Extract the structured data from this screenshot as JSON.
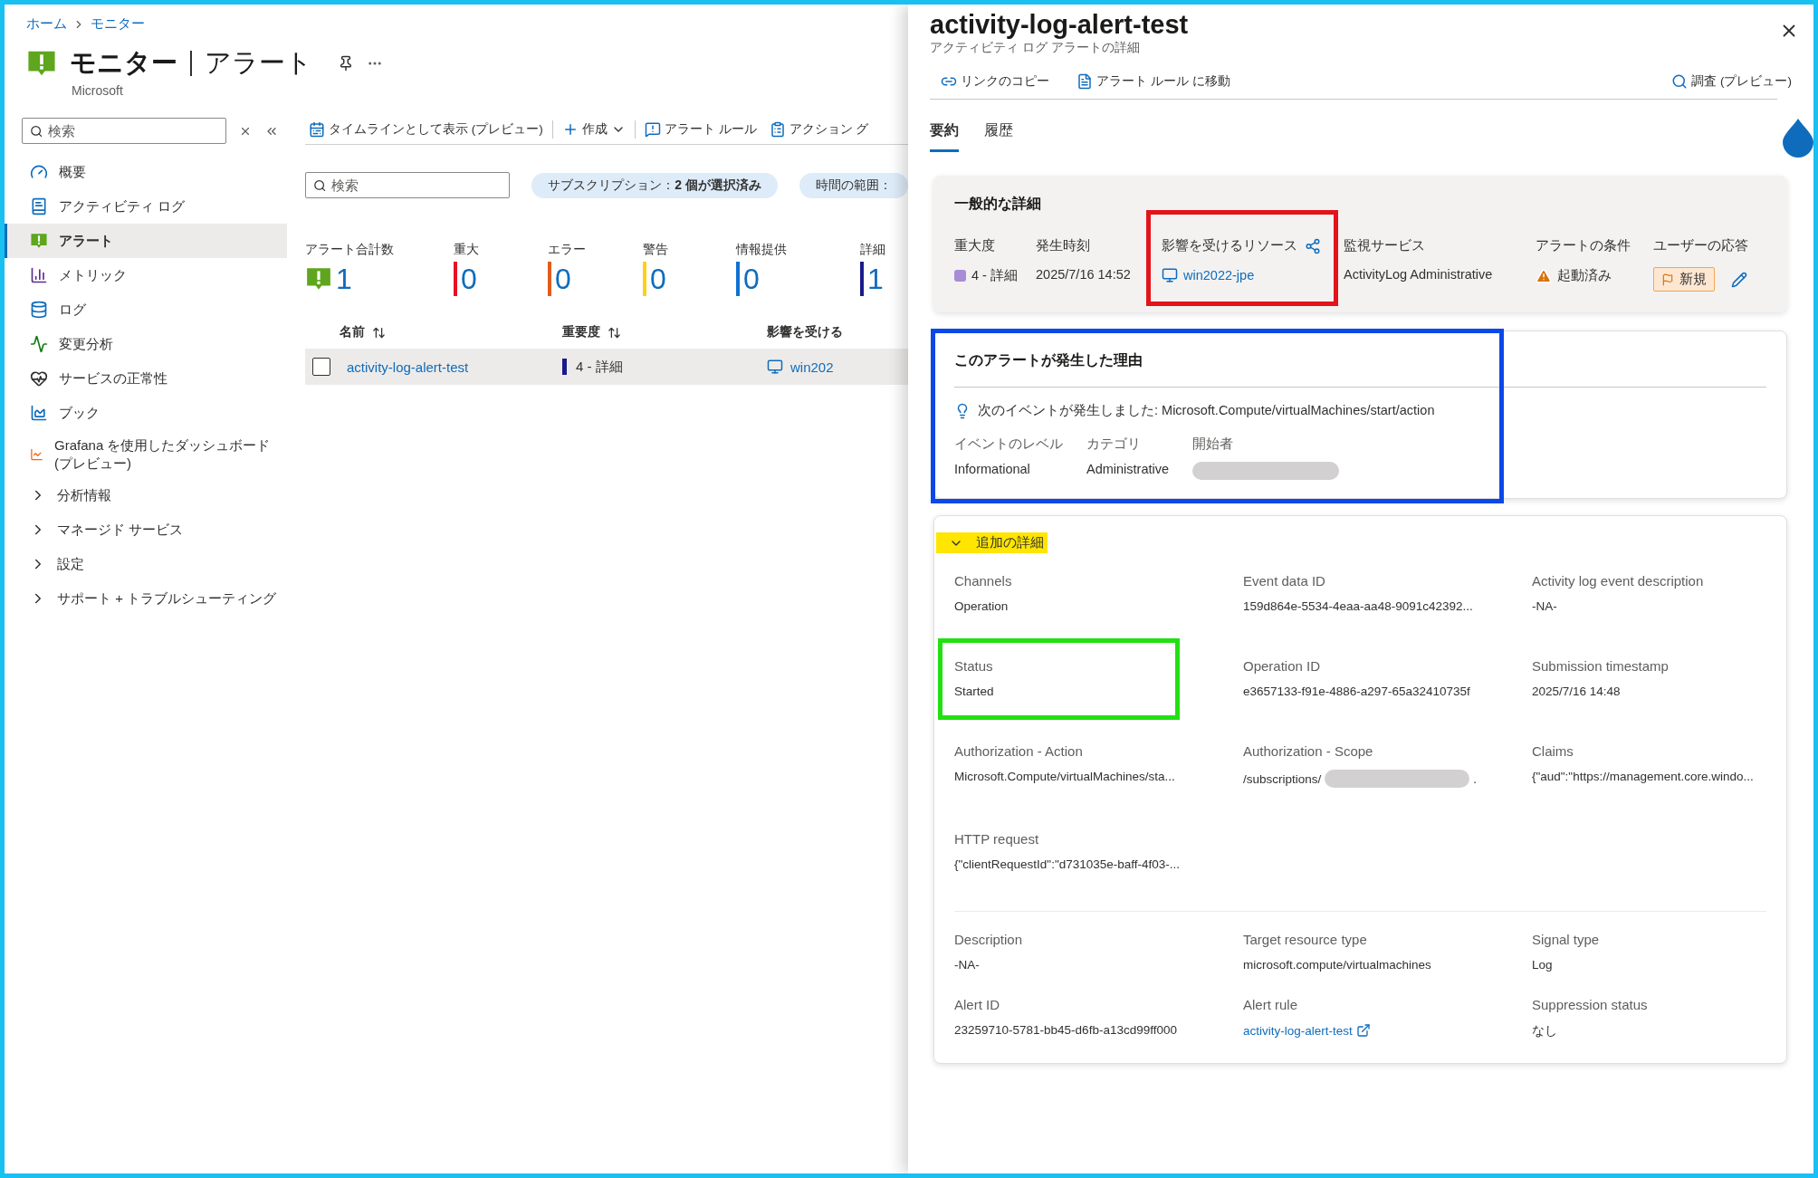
{
  "breadcrumb": [
    {
      "label": "ホーム"
    },
    {
      "label": "モニター"
    }
  ],
  "page": {
    "title": "モニター",
    "section": "アラート",
    "publisher": "Microsoft"
  },
  "sidebar": {
    "search": {
      "placeholder": "検索"
    },
    "items": [
      {
        "label": "概要",
        "kind": "link",
        "selected": false
      },
      {
        "label": "アクティビティ ログ",
        "kind": "link",
        "selected": false
      },
      {
        "label": "アラート",
        "kind": "link",
        "selected": true
      },
      {
        "label": "メトリック",
        "kind": "link",
        "selected": false
      },
      {
        "label": "ログ",
        "kind": "link",
        "selected": false
      },
      {
        "label": "変更分析",
        "kind": "link",
        "selected": false
      },
      {
        "label": "サービスの正常性",
        "kind": "link",
        "selected": false
      },
      {
        "label": "ブック",
        "kind": "link",
        "selected": false
      },
      {
        "label": "Grafana を使用したダッシュボード (プレビュー)",
        "kind": "link",
        "selected": false
      },
      {
        "label": "分析情報",
        "kind": "group",
        "expanded": false,
        "selected": false
      },
      {
        "label": "マネージド サービス",
        "kind": "group",
        "expanded": false,
        "selected": false
      },
      {
        "label": "設定",
        "kind": "group",
        "expanded": false,
        "selected": false
      },
      {
        "label": "サポート + トラブルシューティング",
        "kind": "group",
        "expanded": false,
        "selected": false
      }
    ]
  },
  "toolbar": [
    {
      "label": "タイムラインとして表示 (プレビュー)",
      "kind": "timeline"
    },
    {
      "label": "作成",
      "kind": "create"
    },
    {
      "label": "アラート ルール",
      "kind": "rule"
    },
    {
      "label": "アクション グ",
      "kind": "action"
    }
  ],
  "filters": {
    "search": {
      "placeholder": "検索"
    },
    "pills": [
      "サブスクリプション：**2 個が選択済み**",
      "時間の範囲："
    ]
  },
  "stats": [
    {
      "label": "アラート合計数",
      "value": "1",
      "kind": "total"
    },
    {
      "label": "重大",
      "value": "0",
      "kind": "severity",
      "color": "#e81123"
    },
    {
      "label": "エラー",
      "value": "0",
      "kind": "severity",
      "color": "#e05c1a"
    },
    {
      "label": "警告",
      "value": "0",
      "kind": "severity",
      "color": "#fcd116"
    },
    {
      "label": "情報提供",
      "value": "0",
      "kind": "severity",
      "color": "#1170cf"
    },
    {
      "label": "詳細",
      "value": "1",
      "kind": "severity",
      "color": "#1a1a8c"
    }
  ],
  "table": {
    "columns": [
      {
        "label": "名前",
        "sortable": true
      },
      {
        "label": "重要度",
        "sortable": true
      },
      {
        "label": "影響を受ける",
        "sortable": false
      }
    ],
    "rows": [
      {
        "checked": false,
        "selected": true,
        "name": "activity-log-alert-test",
        "severity": "4 - 詳細",
        "color": "#1a1a8c",
        "resource": "win202"
      }
    ]
  },
  "panel": {
    "title": "activity-log-alert-test",
    "subtitle": "アクティビティ ログ アラートの詳細",
    "actions": [
      {
        "label": "リンクのコピー",
        "kind": "link"
      },
      {
        "label": "アラート ルール に移動",
        "kind": "rule"
      }
    ],
    "investigate": "調査 (プレビュー)",
    "tabs": [
      {
        "label": "要約",
        "selected": true
      },
      {
        "label": "履歴",
        "selected": false
      }
    ],
    "general": {
      "heading": "一般的な詳細",
      "fields": [
        {
          "kind": "severity",
          "label": "重大度",
          "value": "4 - 詳細",
          "color": "#a98bd6"
        },
        {
          "kind": "text",
          "label": "発生時刻",
          "value": "2025/7/16 14:52"
        },
        {
          "kind": "resource",
          "label": "影響を受けるリソース",
          "value": "win2022-jpe",
          "frame": {
            "color": "#e3131b"
          }
        },
        {
          "kind": "text",
          "label": "監視サービス",
          "value": "ActivityLog Administrative"
        },
        {
          "kind": "condition",
          "label": "アラートの条件",
          "value": "起動済み"
        },
        {
          "kind": "response",
          "label": "ユーザーの応答",
          "value": "新規"
        }
      ]
    },
    "reason": {
      "heading": "このアラートが発生した理由",
      "frame": {
        "color": "#0a48e8"
      },
      "event": "次のイベントが発生しました: Microsoft.Compute/virtualMachines/start/action",
      "fields": [
        {
          "label": "イベントのレベル",
          "value": "Informational",
          "redacted": false
        },
        {
          "label": "カテゴリ",
          "value": "Administrative",
          "redacted": false
        },
        {
          "label": "開始者",
          "redacted": true
        }
      ]
    },
    "additional": {
      "heading": "追加の詳細",
      "expanded": true,
      "highlighted": true,
      "sections": [
        [
          {
            "label": "Channels",
            "value": "Operation"
          },
          {
            "label": "Event data ID",
            "value": "159d864e-5534-4eaa-aa48-9091c42392..."
          },
          {
            "label": "Activity log event description",
            "value": "-NA-"
          },
          {
            "label": "Status",
            "value": "Started",
            "frame": {
              "color": "#22e012"
            }
          },
          {
            "label": "Operation ID",
            "value": "e3657133-f91e-4886-a297-65a32410735f"
          },
          {
            "label": "Submission timestamp",
            "value": "2025/7/16 14:48"
          },
          {
            "label": "Authorization - Action",
            "value": "Microsoft.Compute/virtualMachines/sta..."
          },
          {
            "label": "Authorization - Scope",
            "value": "/subscriptions/",
            "redacted": true,
            "suffix": "."
          },
          {
            "label": "Claims",
            "value": "{\"aud\":\"https://management.core.windo..."
          },
          {
            "label": "HTTP request",
            "value": "{\"clientRequestId\":\"d731035e-baff-4f03-..."
          }
        ],
        [
          {
            "label": "Description",
            "value": "-NA-"
          },
          {
            "label": "Target resource type",
            "value": "microsoft.compute/virtualmachines"
          },
          {
            "label": "Signal type",
            "value": "Log"
          },
          {
            "label": "Alert ID",
            "value": "23259710-5781-bb45-d6fb-a13cd99ff000"
          },
          {
            "label": "Alert rule",
            "value": "activity-log-alert-test",
            "kind": "link"
          },
          {
            "label": "Suppression status",
            "value": "なし"
          }
        ]
      ]
    }
  }
}
